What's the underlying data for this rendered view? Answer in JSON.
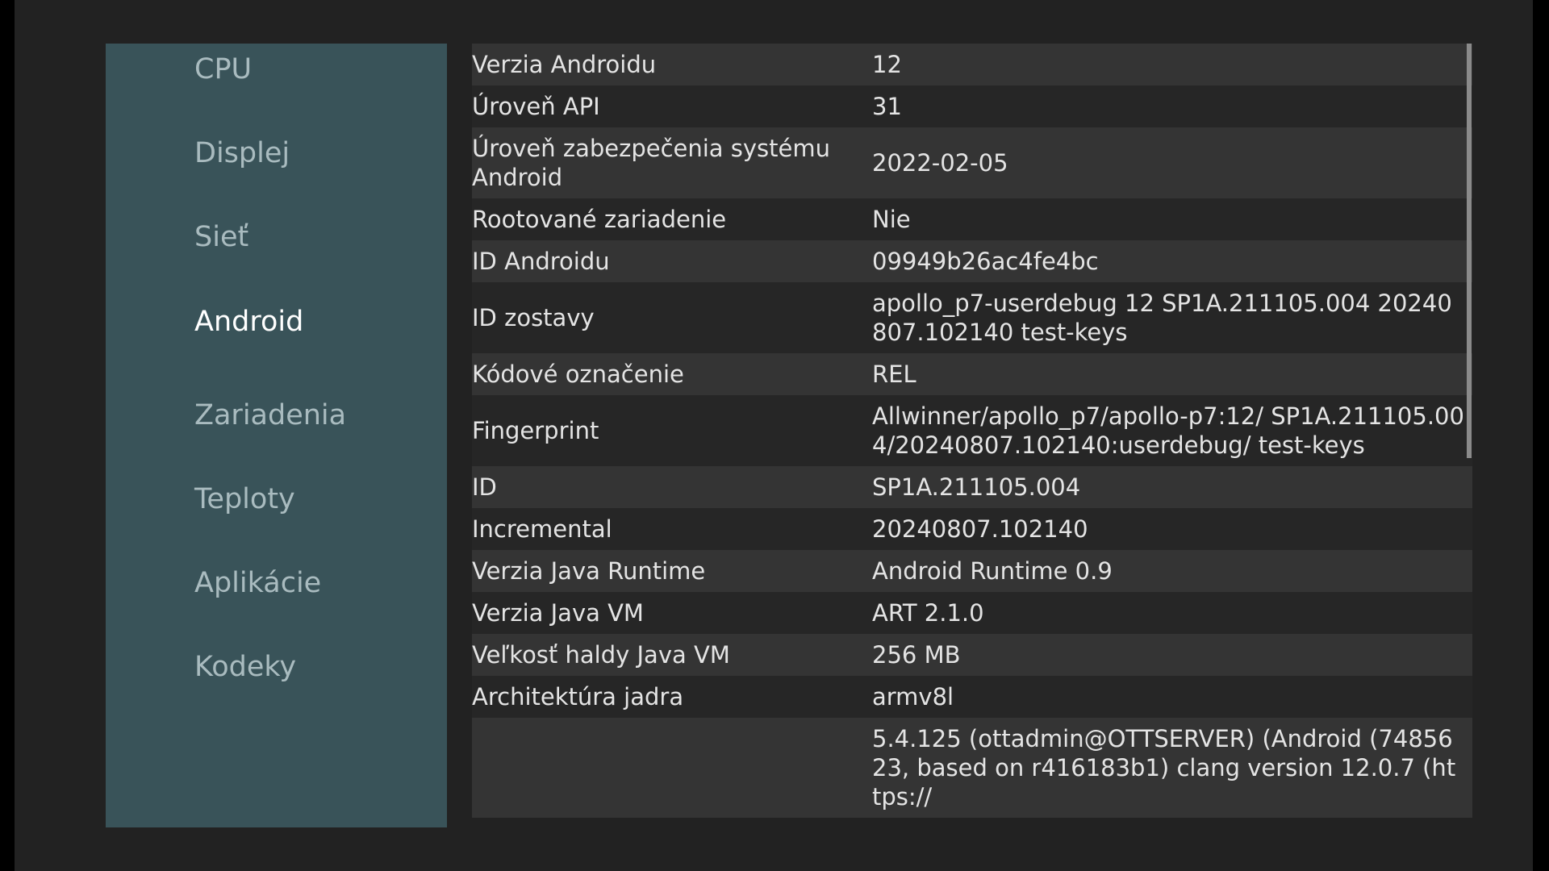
{
  "sidebar": {
    "items": [
      {
        "label": "CPU"
      },
      {
        "label": "Displej"
      },
      {
        "label": "Sieť"
      },
      {
        "label": "Android"
      },
      {
        "label": "Zariadenia"
      },
      {
        "label": "Teploty"
      },
      {
        "label": "Aplikácie"
      },
      {
        "label": "Kodeky"
      }
    ],
    "active": "Android"
  },
  "rows": [
    {
      "label": "Verzia Androidu",
      "value": "12"
    },
    {
      "label": "Úroveň API",
      "value": "31"
    },
    {
      "label": "Úroveň zabezpečenia systému Android",
      "value": "2022-02-05"
    },
    {
      "label": "Rootované zariadenie",
      "value": "Nie"
    },
    {
      "label": "ID Androidu",
      "value": "09949b26ac4fe4bc"
    },
    {
      "label": "ID zostavy",
      "value": "apollo_p7-userdebug 12 SP1A.211105.004 20240807.102140 test-keys"
    },
    {
      "label": "Kódové označenie",
      "value": "REL"
    },
    {
      "label": "Fingerprint",
      "value": "Allwinner/apollo_p7/apollo-p7:12/ SP1A.211105.004/20240807.102140:userdebug/ test-keys"
    },
    {
      "label": "ID",
      "value": "SP1A.211105.004"
    },
    {
      "label": "Incremental",
      "value": "20240807.102140"
    },
    {
      "label": "Verzia Java Runtime",
      "value": "Android Runtime 0.9"
    },
    {
      "label": "Verzia Java VM",
      "value": "ART 2.1.0"
    },
    {
      "label": "Veľkosť haldy Java VM",
      "value": "256 MB"
    },
    {
      "label": "Architektúra jadra",
      "value": "armv8l"
    },
    {
      "label": "",
      "value": "5.4.125 (ottadmin@OTTSERVER) (Android (7485623, based on r416183b1) clang version 12.0.7 (https://"
    }
  ],
  "colors": {
    "background": "#222222",
    "sidebar": "#395359",
    "row_odd": "#343434",
    "row_even": "#262626",
    "active_text": "#ffffff",
    "inactive_text": "#a9bbbf"
  }
}
